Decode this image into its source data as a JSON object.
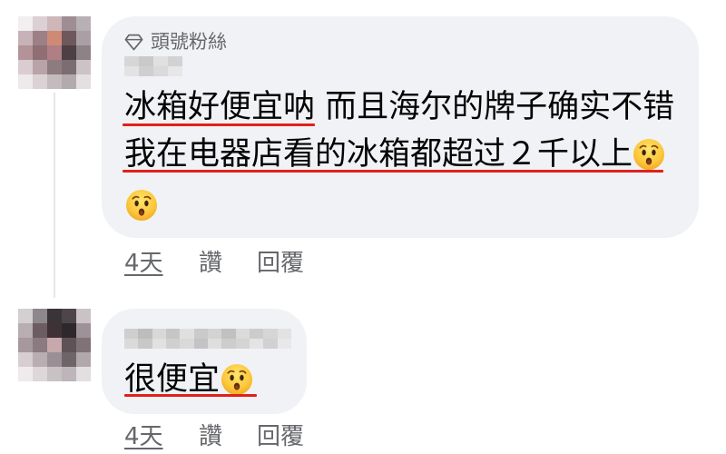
{
  "comments": [
    {
      "badge_icon": "diamond-icon",
      "badge_label": "頭號粉絲",
      "lines": [
        "冰箱好便宜呐 而且海尔的牌子确实不错",
        "我在电器店看的冰箱都超过２千以上"
      ],
      "emojis": [
        "hushed-face",
        "hushed-face"
      ],
      "time": "4天",
      "like_label": "讚",
      "reply_label": "回覆"
    },
    {
      "lines": [
        "很便宜"
      ],
      "emojis": [
        "hushed-face"
      ],
      "time": "4天",
      "like_label": "讚",
      "reply_label": "回覆"
    }
  ],
  "colors": {
    "bubble_background": "#f0f2f5",
    "primary_text": "#050505",
    "secondary_text": "#65676b",
    "annotation_underline": "#e3201b",
    "thread_line": "#e4e6eb"
  }
}
